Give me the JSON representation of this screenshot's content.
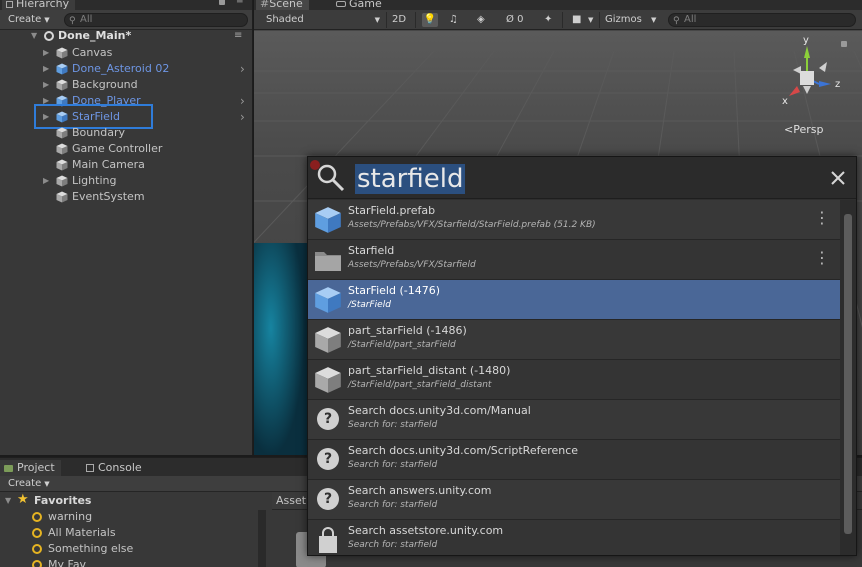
{
  "hierarchy": {
    "tab_label": "Hierarchy",
    "create_label": "Create",
    "search_placeholder": "All",
    "scene_name": "Done_Main*",
    "items": [
      {
        "label": "Canvas"
      },
      {
        "label": "Done_Asteroid 02"
      },
      {
        "label": "Background"
      },
      {
        "label": "Done_Player"
      },
      {
        "label": "StarField"
      },
      {
        "label": "Boundary"
      },
      {
        "label": "Game Controller"
      },
      {
        "label": "Main Camera"
      },
      {
        "label": "Lighting"
      },
      {
        "label": "EventSystem"
      }
    ]
  },
  "scene": {
    "tab_scene": "Scene",
    "tab_game": "Game",
    "shading_mode": "Shaded",
    "mode_2d": "2D",
    "hidden_count": "0",
    "gizmos_label": "Gizmos",
    "search_placeholder": "All",
    "gizmo_axis_x": "x",
    "gizmo_axis_y": "y",
    "gizmo_axis_z": "z",
    "projection_label": "Persp"
  },
  "project": {
    "tab_project": "Project",
    "tab_console": "Console",
    "create_label": "Create",
    "favorites_label": "Favorites",
    "favorites": [
      {
        "label": "warning"
      },
      {
        "label": "All Materials"
      },
      {
        "label": "Something else"
      },
      {
        "label": "My Fav"
      }
    ],
    "assets_label": "Asset"
  },
  "quick_search": {
    "query": "starfield",
    "results": [
      {
        "title": "StarField.prefab",
        "subtitle": "Assets/Prefabs/VFX/Starfield/StarField.prefab (51.2 KB)",
        "icon": "prefab-cube-icon",
        "has_menu": true
      },
      {
        "title": "Starfield",
        "subtitle": "Assets/Prefabs/VFX/Starfield",
        "icon": "folder-icon",
        "has_menu": true
      },
      {
        "title": "StarField (-1476)",
        "subtitle": "/StarField",
        "icon": "prefab-cube-icon",
        "selected": true
      },
      {
        "title": "part_starField (-1486)",
        "subtitle": "/StarField/part_starField",
        "icon": "gameobject-cube-icon"
      },
      {
        "title": "part_starField_distant (-1480)",
        "subtitle": "/StarField/part_starField_distant",
        "icon": "gameobject-cube-icon"
      },
      {
        "title": "Search docs.unity3d.com/Manual",
        "subtitle": "Search for: starfield",
        "icon": "help-icon"
      },
      {
        "title": "Search docs.unity3d.com/ScriptReference",
        "subtitle": "Search for: starfield",
        "icon": "help-icon"
      },
      {
        "title": "Search answers.unity.com",
        "subtitle": "Search for: starfield",
        "icon": "help-icon"
      },
      {
        "title": "Search assetstore.unity.com",
        "subtitle": "Search for: starfield",
        "icon": "store-bag-icon"
      }
    ]
  },
  "colors": {
    "selection_blue": "#4a6797",
    "prefab_blue": "#6e96e4",
    "highlight_box": "#2f7cd9"
  }
}
